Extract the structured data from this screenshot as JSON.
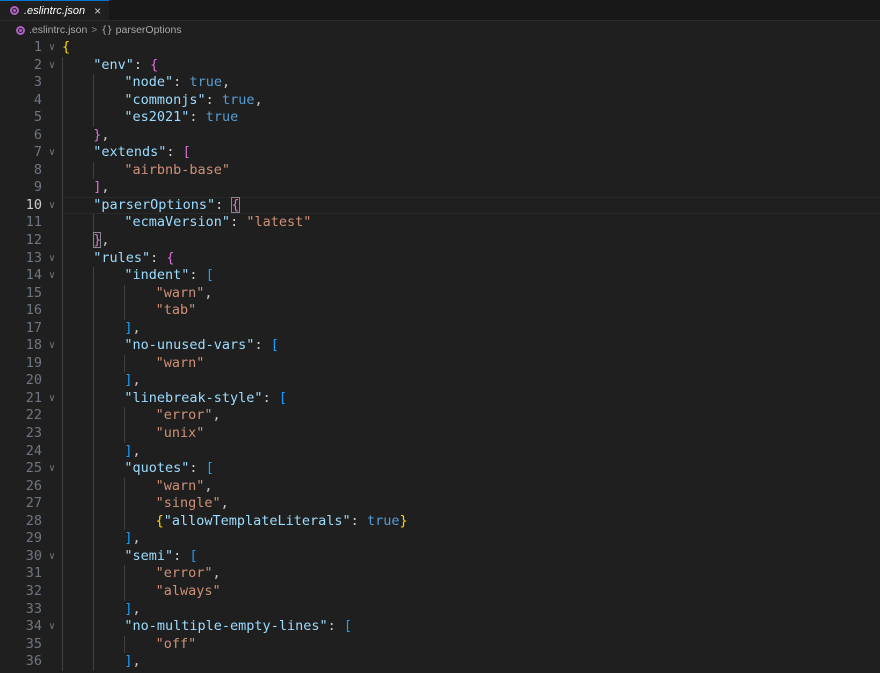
{
  "tab": {
    "filename": ".eslintrc.json",
    "close_icon": "×"
  },
  "breadcrumb": {
    "file": ".eslintrc.json",
    "separator": ">",
    "braces": "{}",
    "symbol": "parserOptions"
  },
  "editor": {
    "current_line": 10,
    "lines": [
      {
        "n": 1,
        "fold": true,
        "indent": 0,
        "tokens": [
          {
            "t": "{",
            "c": "b1"
          }
        ]
      },
      {
        "n": 2,
        "fold": true,
        "indent": 1,
        "tokens": [
          {
            "t": "\"env\"",
            "c": "key"
          },
          {
            "t": ": ",
            "c": "punc"
          },
          {
            "t": "{",
            "c": "b2"
          }
        ]
      },
      {
        "n": 3,
        "fold": false,
        "indent": 2,
        "tokens": [
          {
            "t": "\"node\"",
            "c": "key"
          },
          {
            "t": ": ",
            "c": "punc"
          },
          {
            "t": "true",
            "c": "bool"
          },
          {
            "t": ",",
            "c": "punc"
          }
        ]
      },
      {
        "n": 4,
        "fold": false,
        "indent": 2,
        "tokens": [
          {
            "t": "\"commonjs\"",
            "c": "key"
          },
          {
            "t": ": ",
            "c": "punc"
          },
          {
            "t": "true",
            "c": "bool"
          },
          {
            "t": ",",
            "c": "punc"
          }
        ]
      },
      {
        "n": 5,
        "fold": false,
        "indent": 2,
        "tokens": [
          {
            "t": "\"es2021\"",
            "c": "key"
          },
          {
            "t": ": ",
            "c": "punc"
          },
          {
            "t": "true",
            "c": "bool"
          }
        ]
      },
      {
        "n": 6,
        "fold": false,
        "indent": 1,
        "tokens": [
          {
            "t": "}",
            "c": "b2"
          },
          {
            "t": ",",
            "c": "punc"
          }
        ]
      },
      {
        "n": 7,
        "fold": true,
        "indent": 1,
        "tokens": [
          {
            "t": "\"extends\"",
            "c": "key"
          },
          {
            "t": ": ",
            "c": "punc"
          },
          {
            "t": "[",
            "c": "b2"
          }
        ]
      },
      {
        "n": 8,
        "fold": false,
        "indent": 2,
        "tokens": [
          {
            "t": "\"airbnb-base\"",
            "c": "str"
          }
        ]
      },
      {
        "n": 9,
        "fold": false,
        "indent": 1,
        "tokens": [
          {
            "t": "]",
            "c": "b2"
          },
          {
            "t": ",",
            "c": "punc"
          }
        ]
      },
      {
        "n": 10,
        "fold": true,
        "indent": 1,
        "tokens": [
          {
            "t": "\"parserOptions\"",
            "c": "key"
          },
          {
            "t": ": ",
            "c": "punc"
          },
          {
            "t": "{",
            "c": "b2 match"
          }
        ]
      },
      {
        "n": 11,
        "fold": false,
        "indent": 2,
        "tokens": [
          {
            "t": "\"ecmaVersion\"",
            "c": "key"
          },
          {
            "t": ": ",
            "c": "punc"
          },
          {
            "t": "\"latest\"",
            "c": "str"
          }
        ]
      },
      {
        "n": 12,
        "fold": false,
        "indent": 1,
        "tokens": [
          {
            "t": "}",
            "c": "b2 match"
          },
          {
            "t": ",",
            "c": "punc"
          }
        ]
      },
      {
        "n": 13,
        "fold": true,
        "indent": 1,
        "tokens": [
          {
            "t": "\"rules\"",
            "c": "key"
          },
          {
            "t": ": ",
            "c": "punc"
          },
          {
            "t": "{",
            "c": "b2"
          }
        ]
      },
      {
        "n": 14,
        "fold": true,
        "indent": 2,
        "tokens": [
          {
            "t": "\"indent\"",
            "c": "key"
          },
          {
            "t": ": ",
            "c": "punc"
          },
          {
            "t": "[",
            "c": "b3"
          }
        ]
      },
      {
        "n": 15,
        "fold": false,
        "indent": 3,
        "tokens": [
          {
            "t": "\"warn\"",
            "c": "str"
          },
          {
            "t": ",",
            "c": "punc"
          }
        ]
      },
      {
        "n": 16,
        "fold": false,
        "indent": 3,
        "tokens": [
          {
            "t": "\"tab\"",
            "c": "str"
          }
        ]
      },
      {
        "n": 17,
        "fold": false,
        "indent": 2,
        "tokens": [
          {
            "t": "]",
            "c": "b3"
          },
          {
            "t": ",",
            "c": "punc"
          }
        ]
      },
      {
        "n": 18,
        "fold": true,
        "indent": 2,
        "tokens": [
          {
            "t": "\"no-unused-vars\"",
            "c": "key"
          },
          {
            "t": ": ",
            "c": "punc"
          },
          {
            "t": "[",
            "c": "b3"
          }
        ]
      },
      {
        "n": 19,
        "fold": false,
        "indent": 3,
        "tokens": [
          {
            "t": "\"warn\"",
            "c": "str"
          }
        ]
      },
      {
        "n": 20,
        "fold": false,
        "indent": 2,
        "tokens": [
          {
            "t": "]",
            "c": "b3"
          },
          {
            "t": ",",
            "c": "punc"
          }
        ]
      },
      {
        "n": 21,
        "fold": true,
        "indent": 2,
        "tokens": [
          {
            "t": "\"linebreak-style\"",
            "c": "key"
          },
          {
            "t": ": ",
            "c": "punc"
          },
          {
            "t": "[",
            "c": "b3"
          }
        ]
      },
      {
        "n": 22,
        "fold": false,
        "indent": 3,
        "tokens": [
          {
            "t": "\"error\"",
            "c": "str"
          },
          {
            "t": ",",
            "c": "punc"
          }
        ]
      },
      {
        "n": 23,
        "fold": false,
        "indent": 3,
        "tokens": [
          {
            "t": "\"unix\"",
            "c": "str"
          }
        ]
      },
      {
        "n": 24,
        "fold": false,
        "indent": 2,
        "tokens": [
          {
            "t": "]",
            "c": "b3"
          },
          {
            "t": ",",
            "c": "punc"
          }
        ]
      },
      {
        "n": 25,
        "fold": true,
        "indent": 2,
        "tokens": [
          {
            "t": "\"quotes\"",
            "c": "key"
          },
          {
            "t": ": ",
            "c": "punc"
          },
          {
            "t": "[",
            "c": "b3"
          }
        ]
      },
      {
        "n": 26,
        "fold": false,
        "indent": 3,
        "tokens": [
          {
            "t": "\"warn\"",
            "c": "str"
          },
          {
            "t": ",",
            "c": "punc"
          }
        ]
      },
      {
        "n": 27,
        "fold": false,
        "indent": 3,
        "tokens": [
          {
            "t": "\"single\"",
            "c": "str"
          },
          {
            "t": ",",
            "c": "punc"
          }
        ]
      },
      {
        "n": 28,
        "fold": false,
        "indent": 3,
        "tokens": [
          {
            "t": "{",
            "c": "b1"
          },
          {
            "t": "\"allowTemplateLiterals\"",
            "c": "key"
          },
          {
            "t": ": ",
            "c": "punc"
          },
          {
            "t": "true",
            "c": "bool"
          },
          {
            "t": "}",
            "c": "b1"
          }
        ]
      },
      {
        "n": 29,
        "fold": false,
        "indent": 2,
        "tokens": [
          {
            "t": "]",
            "c": "b3"
          },
          {
            "t": ",",
            "c": "punc"
          }
        ]
      },
      {
        "n": 30,
        "fold": true,
        "indent": 2,
        "tokens": [
          {
            "t": "\"semi\"",
            "c": "key"
          },
          {
            "t": ": ",
            "c": "punc"
          },
          {
            "t": "[",
            "c": "b3"
          }
        ]
      },
      {
        "n": 31,
        "fold": false,
        "indent": 3,
        "tokens": [
          {
            "t": "\"error\"",
            "c": "str"
          },
          {
            "t": ",",
            "c": "punc"
          }
        ]
      },
      {
        "n": 32,
        "fold": false,
        "indent": 3,
        "tokens": [
          {
            "t": "\"always\"",
            "c": "str"
          }
        ]
      },
      {
        "n": 33,
        "fold": false,
        "indent": 2,
        "tokens": [
          {
            "t": "]",
            "c": "b3"
          },
          {
            "t": ",",
            "c": "punc"
          }
        ]
      },
      {
        "n": 34,
        "fold": true,
        "indent": 2,
        "tokens": [
          {
            "t": "\"no-multiple-empty-lines\"",
            "c": "key"
          },
          {
            "t": ": ",
            "c": "punc"
          },
          {
            "t": "[",
            "c": "b3"
          }
        ]
      },
      {
        "n": 35,
        "fold": false,
        "indent": 3,
        "tokens": [
          {
            "t": "\"off\"",
            "c": "str"
          }
        ]
      },
      {
        "n": 36,
        "fold": false,
        "indent": 2,
        "tokens": [
          {
            "t": "]",
            "c": "b3"
          },
          {
            "t": ",",
            "c": "punc"
          }
        ]
      }
    ]
  }
}
